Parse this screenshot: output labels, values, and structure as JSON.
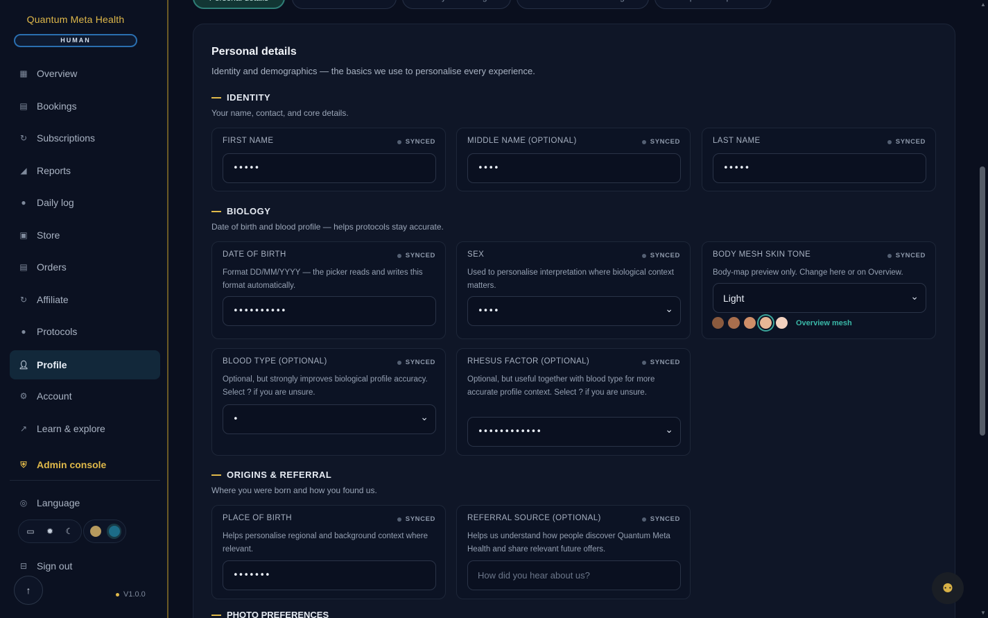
{
  "brand": {
    "name": "Quantum Meta Health",
    "badge": "HUMAN"
  },
  "sidebar": {
    "items": [
      {
        "label": "Overview",
        "icon": "grid-icon"
      },
      {
        "label": "Bookings",
        "icon": "calendar-icon"
      },
      {
        "label": "Subscriptions",
        "icon": "refresh-icon"
      },
      {
        "label": "Reports",
        "icon": "chart-icon"
      },
      {
        "label": "Daily log",
        "icon": "droplet-icon"
      },
      {
        "label": "Store",
        "icon": "bag-icon"
      },
      {
        "label": "Orders",
        "icon": "box-icon"
      },
      {
        "label": "Affiliate",
        "icon": "link-icon"
      },
      {
        "label": "Protocols",
        "icon": "flask-icon"
      },
      {
        "label": "Profile",
        "icon": "user-icon"
      },
      {
        "label": "Account",
        "icon": "gear-icon"
      },
      {
        "label": "Learn & explore",
        "icon": "external-icon"
      }
    ],
    "admin": "Admin console",
    "language": "Language",
    "signout": "Sign out",
    "version": "V1.0.0"
  },
  "tabs": [
    "Personal details",
    "Treatment context",
    "Lifestyle & settings",
    "Technical & monitoring",
    "Compliance & policies"
  ],
  "page": {
    "title": "Personal details",
    "subtitle": "Identity and demographics — the basics we use to personalise every experience."
  },
  "sync_label": "SYNCED",
  "identity": {
    "title": "IDENTITY",
    "subtitle": "Your name, contact, and core details.",
    "first_name": {
      "label": "FIRST NAME",
      "value": "•••••"
    },
    "middle_name": {
      "label": "MIDDLE NAME (OPTIONAL)",
      "value": "••••"
    },
    "last_name": {
      "label": "LAST NAME",
      "value": "•••••"
    }
  },
  "biology": {
    "title": "BIOLOGY",
    "subtitle": "Date of birth and blood profile — helps protocols stay accurate.",
    "dob": {
      "label": "DATE OF BIRTH",
      "desc": "Format DD/MM/YYYY — the picker reads and writes this format automatically.",
      "value": "••••••••••"
    },
    "sex": {
      "label": "SEX",
      "desc": "Used to personalise interpretation where biological context matters.",
      "value": "••••"
    },
    "skin": {
      "label": "BODY MESH SKIN TONE",
      "desc": "Body-map preview only. Change here or on Overview.",
      "value": "Light",
      "link": "Overview mesh",
      "tones": [
        "#8a5a3e",
        "#a86e4d",
        "#cf8e68",
        "#e7b796",
        "#f3d2c0"
      ]
    },
    "blood": {
      "label": "BLOOD TYPE (OPTIONAL)",
      "desc": "Optional, but strongly improves biological profile accuracy. Select ? if you are unsure.",
      "value": "•"
    },
    "rhesus": {
      "label": "RHESUS FACTOR (OPTIONAL)",
      "desc": "Optional, but useful together with blood type for more accurate profile context. Select ? if you are unsure.",
      "value": "••••••••••••"
    }
  },
  "origins": {
    "title": "ORIGINS & REFERRAL",
    "subtitle": "Where you were born and how you found us.",
    "birthplace": {
      "label": "PLACE OF BIRTH",
      "desc": "Helps personalise regional and background context where relevant.",
      "value": "•••••••"
    },
    "referral": {
      "label": "REFERRAL SOURCE (OPTIONAL)",
      "desc": "Helps us understand how people discover Quantum Meta Health and share relevant future offers.",
      "placeholder": "How did you hear about us?"
    }
  },
  "next_section": "PHOTO PREFERENCES"
}
